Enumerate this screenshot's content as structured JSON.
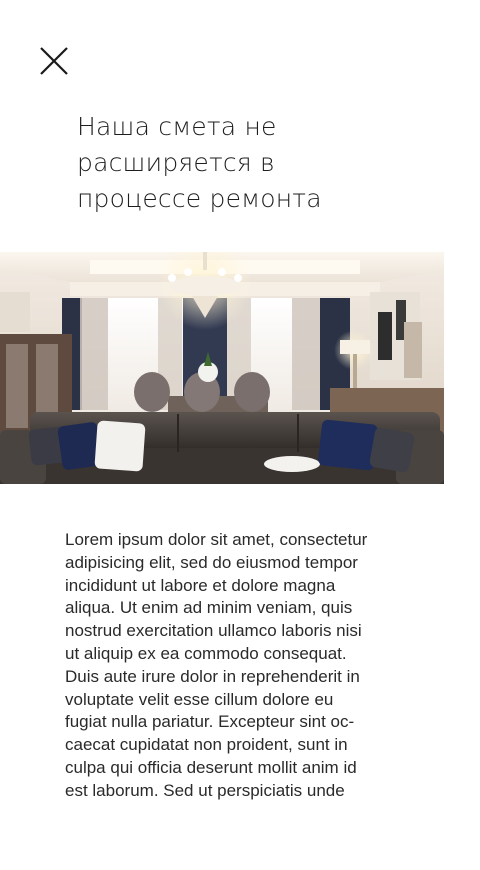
{
  "header": {
    "close_icon": "close-icon"
  },
  "title": "Наша смета не\nрасширяется в\nпроцессе ремонта",
  "image": {
    "subject": "interior-living-room-photo"
  },
  "body_text": "Lorem ipsum dolor sit amet, consectetur\nadipisicing elit, sed do eiusmod tempor\nincididunt ut labore et dolore magna\naliqua. Ut enim ad minim veniam, quis\nnostrud exercitation ullamco laboris nisi\nut aliquip ex ea commodo consequat.\nDuis aute irure dolor in reprehenderit in\nvoluptate velit esse cillum dolore eu\nfugiat nulla pariatur. Excepteur sint oc-\ncaecat cupidatat non proident, sunt in\nculpa qui officia deserunt mollit anim id\nest laborum. Sed ut perspiciatis unde"
}
